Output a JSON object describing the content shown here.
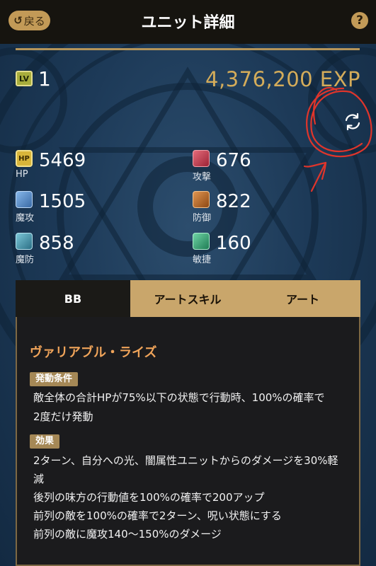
{
  "header": {
    "back_label": "戻る",
    "back_icon": "undo-icon",
    "title": "ユニット詳細",
    "help_label": "?"
  },
  "level": {
    "badge": "LV",
    "value": "1",
    "exp": "4,376,200 EXP"
  },
  "stats": [
    {
      "key": "hp",
      "badge": "HP",
      "label": "HP",
      "value": "5469",
      "color": "#d8b53a"
    },
    {
      "key": "atk",
      "badge": "",
      "label": "攻撃",
      "value": "676",
      "color": "#c24657"
    },
    {
      "key": "matk",
      "badge": "",
      "label": "魔攻",
      "value": "1505",
      "color": "#5b8fc9"
    },
    {
      "key": "def",
      "badge": "",
      "label": "防御",
      "value": "822",
      "color": "#c06a2c"
    },
    {
      "key": "mdef",
      "badge": "",
      "label": "魔防",
      "value": "858",
      "color": "#4b9fb6"
    },
    {
      "key": "agi",
      "badge": "",
      "label": "敏捷",
      "value": "160",
      "color": "#3aa37a"
    }
  ],
  "tabs": [
    {
      "label": "BB",
      "active": true
    },
    {
      "label": "アートスキル",
      "active": false
    },
    {
      "label": "アート",
      "active": false
    }
  ],
  "skill": {
    "name": "ヴァリアブル・ライズ",
    "condition_tag": "発動条件",
    "condition_lines": [
      "敵全体の合計HPが75%以下の状態で行動時、100%の確率で",
      "2度だけ発動"
    ],
    "effect_tag": "効果",
    "effect_lines": [
      "2ターン、自分への光、闇属性ユニットからのダメージを30%軽",
      "減",
      "後列の味方の行動値を100%の確率で200アップ",
      "前列の敵を100%の確率で2ターン、呪い状態にする",
      "前列の敵に魔攻140～150%のダメージ"
    ]
  },
  "colors": {
    "accent": "#c9a66b",
    "exp": "#d4ac5a",
    "skill_name": "#f0a45a",
    "annotation": "#e0352b"
  }
}
